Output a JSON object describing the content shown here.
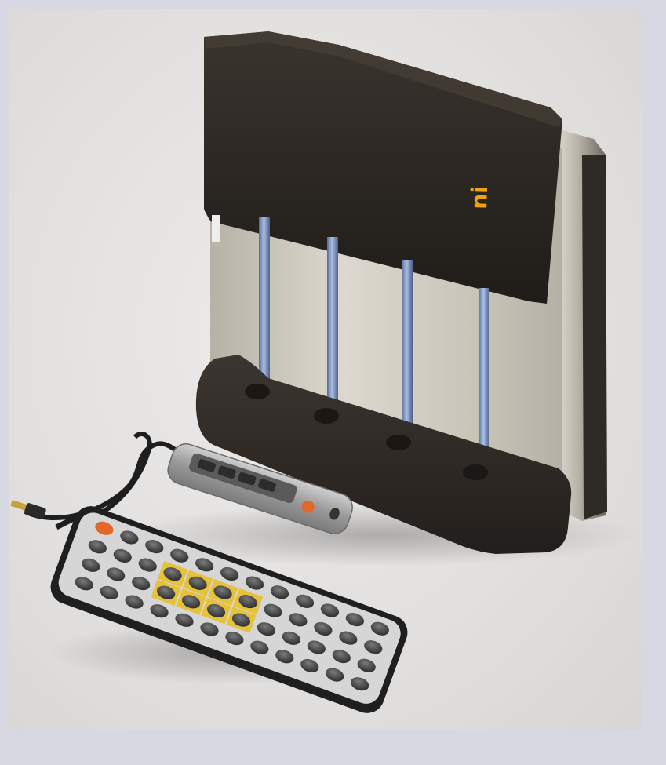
{
  "photo": {
    "alt": "",
    "logo_text": "ni",
    "colors": {
      "backdrop": "#e6e4e2",
      "frame": "#d7d8e1",
      "device_dark": "#2a2622",
      "device_silver": "#c9c5bb",
      "rod_blue": "#7f9bd2",
      "logo_orange": "#f2a10f",
      "remote_yellow": "#e5c13c",
      "remote_orange": "#e4672a"
    }
  }
}
